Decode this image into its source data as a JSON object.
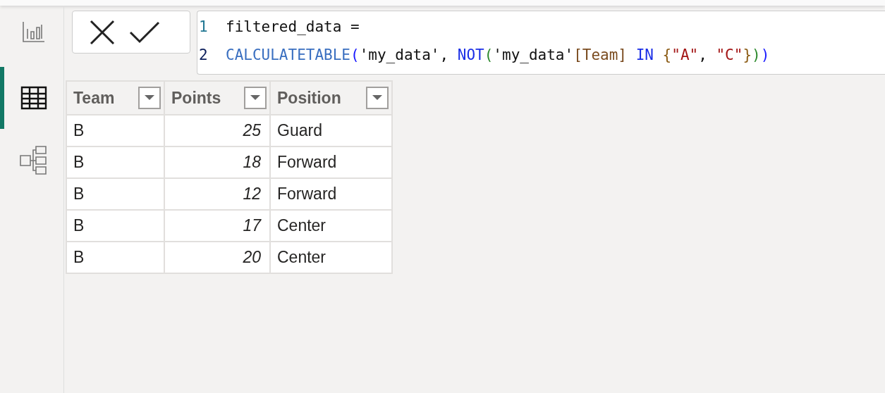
{
  "nav": [
    {
      "kind": "report",
      "selected": false
    },
    {
      "kind": "table",
      "selected": true
    },
    {
      "kind": "model",
      "selected": false
    }
  ],
  "formula": {
    "lines": [
      {
        "number": "1",
        "tokens": [
          {
            "kind": "plain",
            "text": "filtered_data ="
          }
        ]
      },
      {
        "number": "2",
        "tokens": [
          {
            "kind": "function",
            "text": "CALCULATETABLE"
          },
          {
            "kind": "paren1",
            "text": "("
          },
          {
            "kind": "plain",
            "text": "'my_data', "
          },
          {
            "kind": "keyword",
            "text": "NOT"
          },
          {
            "kind": "paren2",
            "text": "("
          },
          {
            "kind": "plain",
            "text": "'my_data'"
          },
          {
            "kind": "column",
            "text": "[Team]"
          },
          {
            "kind": "keyword",
            "text": " IN "
          },
          {
            "kind": "brace",
            "text": "{"
          },
          {
            "kind": "string",
            "text": "\"A\""
          },
          {
            "kind": "plain",
            "text": ", "
          },
          {
            "kind": "string",
            "text": "\"C\""
          },
          {
            "kind": "brace",
            "text": "}"
          },
          {
            "kind": "paren2",
            "text": ")"
          },
          {
            "kind": "paren1",
            "text": ")"
          }
        ]
      }
    ]
  },
  "table": {
    "columns": [
      {
        "label": "Team",
        "kind": "text"
      },
      {
        "label": "Points",
        "kind": "number"
      },
      {
        "label": "Position",
        "kind": "text"
      }
    ],
    "rows": [
      [
        "B",
        "25",
        "Guard"
      ],
      [
        "B",
        "18",
        "Forward"
      ],
      [
        "B",
        "12",
        "Forward"
      ],
      [
        "B",
        "17",
        "Center"
      ],
      [
        "B",
        "20",
        "Center"
      ]
    ]
  }
}
